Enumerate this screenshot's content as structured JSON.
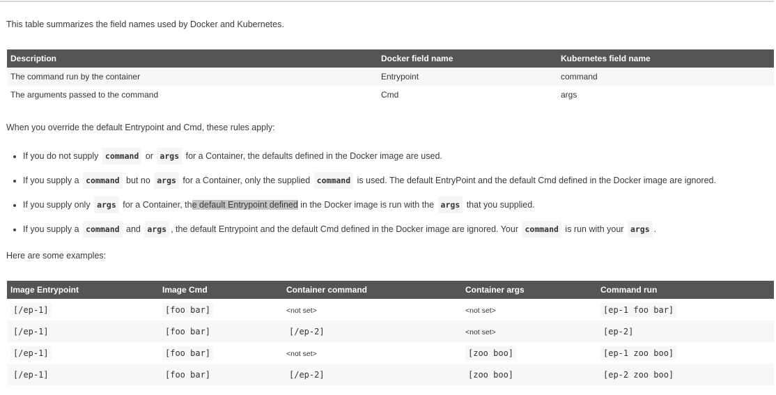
{
  "intro": "This table summarizes the field names used by Docker and Kubernetes.",
  "field_table": {
    "headers": [
      "Description",
      "Docker field name",
      "Kubernetes field name"
    ],
    "rows": [
      [
        "The command run by the container",
        "Entrypoint",
        "command"
      ],
      [
        "The arguments passed to the command",
        "Cmd",
        "args"
      ]
    ]
  },
  "rules_intro": "When you override the default Entrypoint and Cmd, these rules apply:",
  "rules": [
    [
      {
        "t": "If you do not supply "
      },
      {
        "c": "command"
      },
      {
        "t": " or "
      },
      {
        "c": "args"
      },
      {
        "t": " for a Container, the defaults defined in the Docker image are used."
      }
    ],
    [
      {
        "t": "If you supply a "
      },
      {
        "c": "command"
      },
      {
        "t": " but no "
      },
      {
        "c": "args"
      },
      {
        "t": " for a Container, only the supplied "
      },
      {
        "c": "command"
      },
      {
        "t": " is used. The default EntryPoint and the default Cmd defined in the Docker image are ignored."
      }
    ],
    [
      {
        "t": "If you supply only "
      },
      {
        "c": "args"
      },
      {
        "t": " for a Container, th"
      },
      {
        "s": "e default Entrypoint defined"
      },
      {
        "t": " in the Docker image is run with the "
      },
      {
        "c": "args"
      },
      {
        "t": " that you supplied."
      }
    ],
    [
      {
        "t": "If you supply a "
      },
      {
        "c": "command"
      },
      {
        "t": " and "
      },
      {
        "c": "args"
      },
      {
        "t": ", the default Entrypoint and the default Cmd defined in the Docker image are ignored. Your "
      },
      {
        "c": "command"
      },
      {
        "t": " is run with your "
      },
      {
        "c": "args"
      },
      {
        "t": "."
      }
    ]
  ],
  "examples_intro": "Here are some examples:",
  "examples_table": {
    "headers": [
      "Image Entrypoint",
      "Image Cmd",
      "Container command",
      "Container args",
      "Command run"
    ],
    "rows": [
      [
        "[/ep-1]",
        "[foo bar]",
        "<not set>",
        "<not set>",
        "[ep-1 foo bar]"
      ],
      [
        "[/ep-1]",
        "[foo bar]",
        "[/ep-2]",
        "<not set>",
        "[ep-2]"
      ],
      [
        "[/ep-1]",
        "[foo bar]",
        "<not set>",
        "[zoo boo]",
        "[ep-1 zoo boo]"
      ],
      [
        "[/ep-1]",
        "[foo bar]",
        "[/ep-2]",
        "[zoo boo]",
        "[ep-2 zoo boo]"
      ]
    ]
  }
}
